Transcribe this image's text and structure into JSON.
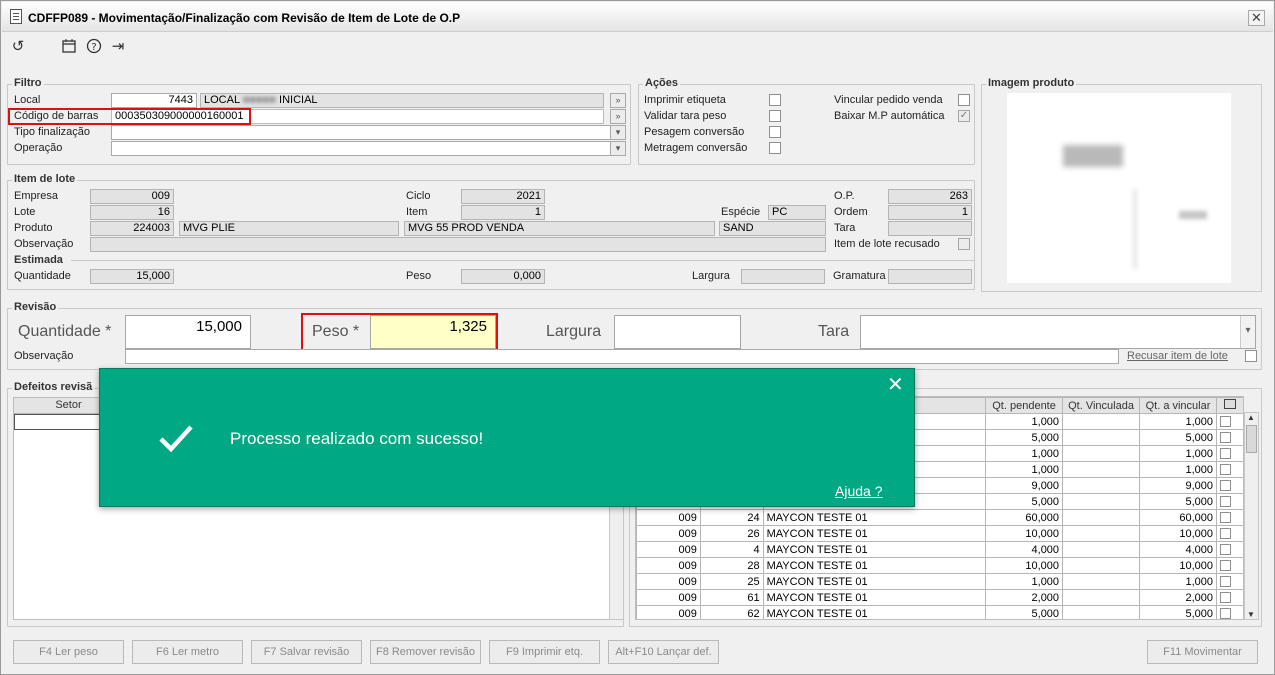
{
  "window": {
    "title": "CDFFP089 - Movimentação/Finalização com Revisão de Item de Lote de O.P",
    "close": "✕"
  },
  "toolbar": {
    "refresh_icon": "↺",
    "calendar_icon": "📅",
    "help_icon": "?",
    "exit_icon": "⇥"
  },
  "filtro": {
    "title": "Filtro",
    "local_label": "Local",
    "local_code": "7443",
    "local_desc_a": "LOCAL",
    "local_desc_b": "INICIAL",
    "barcode_label": "Código de barras",
    "barcode_value": "000350309000000160001",
    "tipo_label": "Tipo finalização",
    "operacao_label": "Operação",
    "more": "»"
  },
  "acoes": {
    "title": "Ações",
    "imprimir": "Imprimir etiqueta",
    "validar": "Validar tara peso",
    "pesagem": "Pesagem conversão",
    "metragem": "Metragem conversão",
    "vincular": "Vincular pedido venda",
    "baixar": "Baixar M.P automática",
    "check": "✓"
  },
  "imagem": {
    "title": "Imagem produto"
  },
  "item": {
    "title": "Item de lote",
    "empresa_label": "Empresa",
    "empresa": "009",
    "lote_label": "Lote",
    "lote": "16",
    "produto_label": "Produto",
    "produto_code": "224003",
    "produto_name": "MVG PLIE",
    "produto_desc": "MVG 55 PROD VENDA",
    "produto_type": "SAND",
    "obs_label": "Observação",
    "ciclo_label": "Ciclo",
    "ciclo": "2021",
    "item_label": "Item",
    "item": "1",
    "especie_label": "Espécie",
    "especie": "PC",
    "op_label": "O.P.",
    "op": "263",
    "ordem_label": "Ordem",
    "ordem": "1",
    "tara_label": "Tara",
    "recusado_label": "Item de lote recusado"
  },
  "estimada": {
    "title": "Estimada",
    "quantidade_label": "Quantidade",
    "quantidade": "15,000",
    "peso_label": "Peso",
    "peso": "0,000",
    "largura_label": "Largura",
    "gramatura_label": "Gramatura"
  },
  "revisao": {
    "title": "Revisão",
    "quantidade_label": "Quantidade *",
    "quantidade": "15,000",
    "peso_label": "Peso *",
    "peso": "1,325",
    "largura_label": "Largura",
    "tara_label": "Tara",
    "obs_label": "Observação",
    "recusar_label": "Recusar item de lote"
  },
  "defeitos": {
    "title": "Defeitos revisã",
    "col_setor": "Setor"
  },
  "grid": {
    "headers": [
      "Qt. pendente",
      "Qt. Vinculada",
      "Qt. a vincular"
    ],
    "rows": [
      {
        "emp": "",
        "num": "",
        "desc": "",
        "pend": "1,000",
        "vinc": "",
        "avinc": "1,000"
      },
      {
        "emp": "",
        "num": "",
        "desc": "",
        "pend": "5,000",
        "vinc": "",
        "avinc": "5,000"
      },
      {
        "emp": "",
        "num": "",
        "desc": "",
        "pend": "1,000",
        "vinc": "",
        "avinc": "1,000"
      },
      {
        "emp": "",
        "num": "",
        "desc": "",
        "pend": "1,000",
        "vinc": "",
        "avinc": "1,000"
      },
      {
        "emp": "",
        "num": "",
        "desc": "",
        "pend": "9,000",
        "vinc": "",
        "avinc": "9,000"
      },
      {
        "emp": "",
        "num": "",
        "desc": "",
        "pend": "5,000",
        "vinc": "",
        "avinc": "5,000"
      },
      {
        "emp": "009",
        "num": "24",
        "desc": "MAYCON TESTE 01",
        "pend": "60,000",
        "vinc": "",
        "avinc": "60,000"
      },
      {
        "emp": "009",
        "num": "26",
        "desc": "MAYCON TESTE 01",
        "pend": "10,000",
        "vinc": "",
        "avinc": "10,000"
      },
      {
        "emp": "009",
        "num": "4",
        "desc": "MAYCON TESTE 01",
        "pend": "4,000",
        "vinc": "",
        "avinc": "4,000"
      },
      {
        "emp": "009",
        "num": "28",
        "desc": "MAYCON TESTE 01",
        "pend": "10,000",
        "vinc": "",
        "avinc": "10,000"
      },
      {
        "emp": "009",
        "num": "25",
        "desc": "MAYCON TESTE 01",
        "pend": "1,000",
        "vinc": "",
        "avinc": "1,000"
      },
      {
        "emp": "009",
        "num": "61",
        "desc": "MAYCON TESTE 01",
        "pend": "2,000",
        "vinc": "",
        "avinc": "2,000"
      },
      {
        "emp": "009",
        "num": "62",
        "desc": "MAYCON TESTE 01",
        "pend": "5,000",
        "vinc": "",
        "avinc": "5,000"
      }
    ]
  },
  "toast": {
    "message": "Processo realizado com sucesso!",
    "help": "Ajuda ?",
    "close": "✕",
    "check": "✓"
  },
  "buttons": {
    "f4": "F4 Ler peso",
    "f6": "F6 Ler metro",
    "f7": "F7 Salvar revisão",
    "f8": "F8 Remover revisão",
    "f9": "F9 Imprimir etq.",
    "altf10": "Alt+F10 Lançar def.",
    "f11": "F11 Movimentar"
  },
  "colors": {
    "toast_bg": "#00a884",
    "highlight": "#d11111",
    "peso_bg": "#ffffc8"
  }
}
